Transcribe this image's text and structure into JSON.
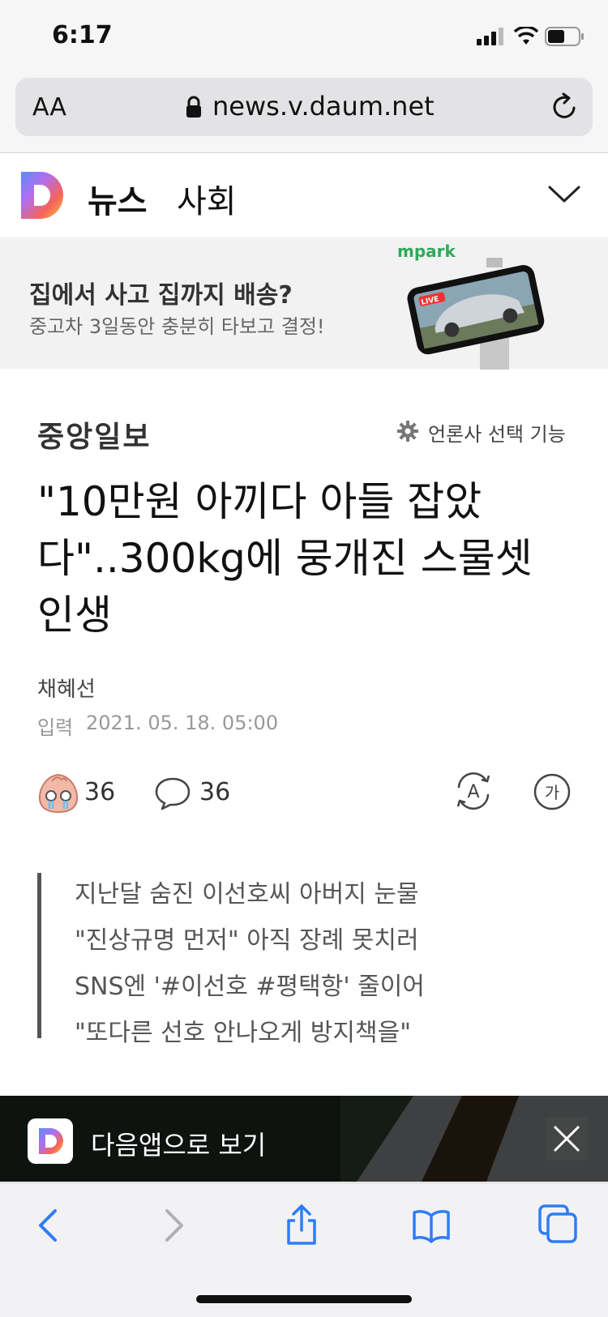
{
  "status_bar": {
    "time": "6:17"
  },
  "browser": {
    "text_size_label": "AA",
    "url": "news.v.daum.net"
  },
  "daum_header": {
    "section_title": "뉴스",
    "category": "사회"
  },
  "ad": {
    "title": "집에서 사고 집까지 배송?",
    "subtitle": "중고차 3일동안 충분히 타보고 결정!",
    "brand": "mpark",
    "live_badge": "LIVE"
  },
  "article": {
    "publisher": "중앙일보",
    "publisher_setting": "언론사 선택 기능",
    "headline_lines": [
      "\"10만원 아끼다 아들 잡았",
      "다\"..300kg에 뭉개진 스물셋",
      "인생"
    ],
    "author": "채혜선",
    "date_label": "입력",
    "date": "2021. 05. 18. 05:00",
    "reaction_count": "36",
    "comment_count": "36",
    "translate_icon_letter": "A",
    "font_size_icon_label": "가",
    "summary": [
      "지난달 숨진 이선호씨 아버지 눈물",
      "\"진상규명 먼저\" 아직 장례 못치러",
      "SNS엔 '#이선호 #평택항' 줄이어",
      "\"또다른 선호 안나오게 방지책을\""
    ]
  },
  "app_banner": {
    "text": "다음앱으로 보기"
  },
  "colors": {
    "accent_green": "#2eaa5a",
    "summary_bar": "#555555",
    "link_blue": "#2f7cf6"
  }
}
